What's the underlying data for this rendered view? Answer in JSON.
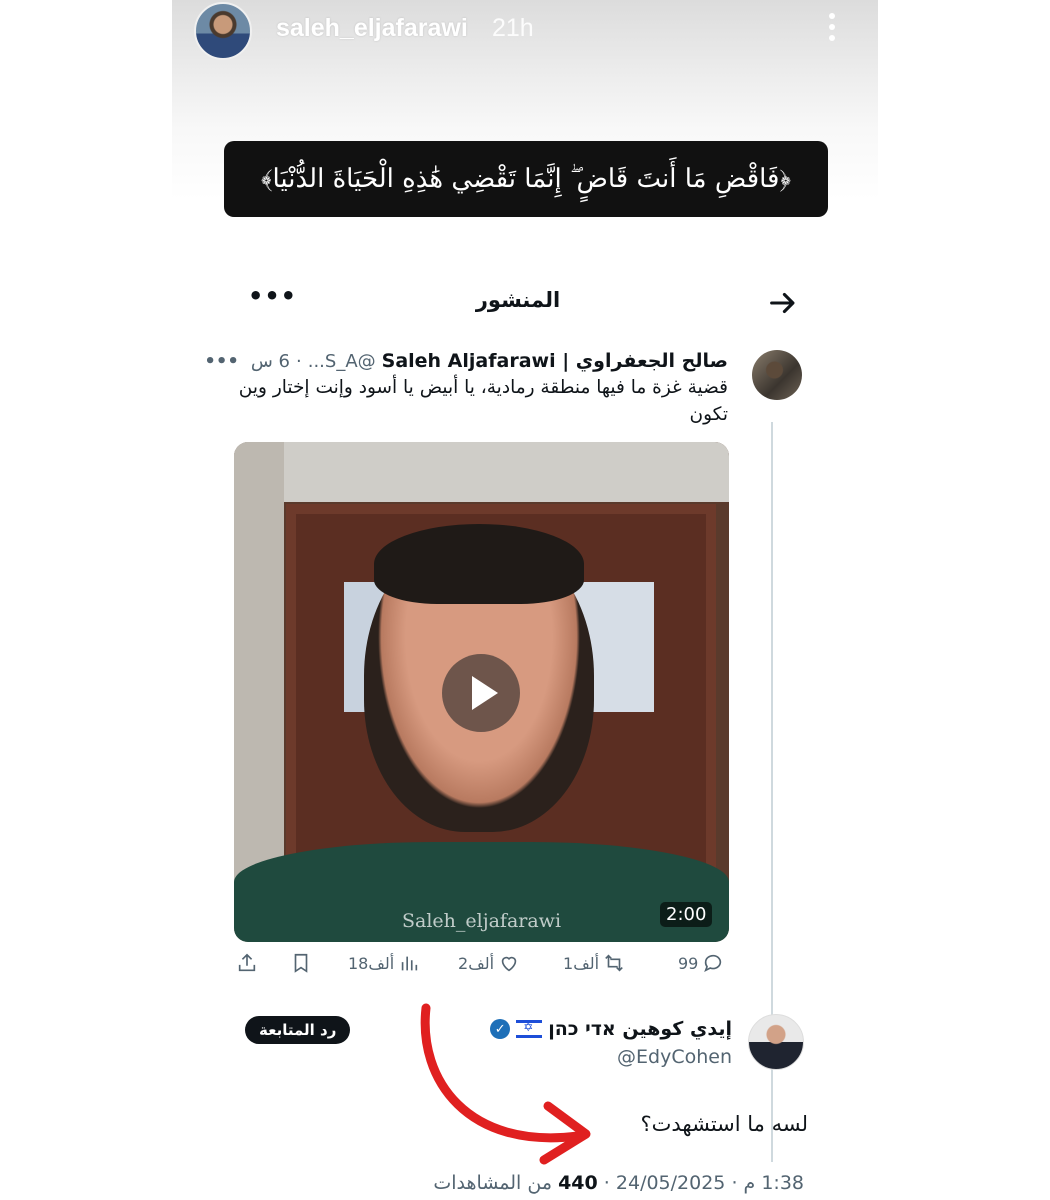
{
  "story": {
    "username": "saleh_eljafarawi",
    "time_ago": "21h",
    "quran_text": "﴿فَاقْضِ مَا أَنتَ قَاضٍ ۖ إِنَّمَا تَقْضِي هَٰذِهِ الْحَيَاةَ الدُّنْيَا﴾"
  },
  "post_screen": {
    "title": "المنشور",
    "more": "•••"
  },
  "tweet": {
    "name": "صالح الجعفراوي | Saleh Aljafarawi",
    "handle": "@S_A...",
    "dot": "·",
    "time": "6 س",
    "more": "•••",
    "text": "قضية غزة ما فيها منطقة رمادية، يا أبيض يا أسود وإنت إختار وين تكون",
    "video": {
      "watermark": "Saleh_eljafarawi",
      "duration": "2:00"
    },
    "stats": {
      "replies": "99",
      "reposts": "1ألف",
      "likes": "2ألف",
      "views": "18ألف"
    }
  },
  "reply": {
    "name": "إيدي كوهين אדי כהן",
    "handle": "@EdyCohen",
    "follow_label": "رد المتابعة",
    "text": "لسه ما استشهدت؟"
  },
  "meta": {
    "datetime": "1:38 م · 24/05/2025 ·",
    "views_count": "440",
    "views_label": "من المشاهدات"
  },
  "colors": {
    "accent": "#1d9bf0",
    "arrow": "#e02020",
    "text_secondary": "#536471"
  }
}
